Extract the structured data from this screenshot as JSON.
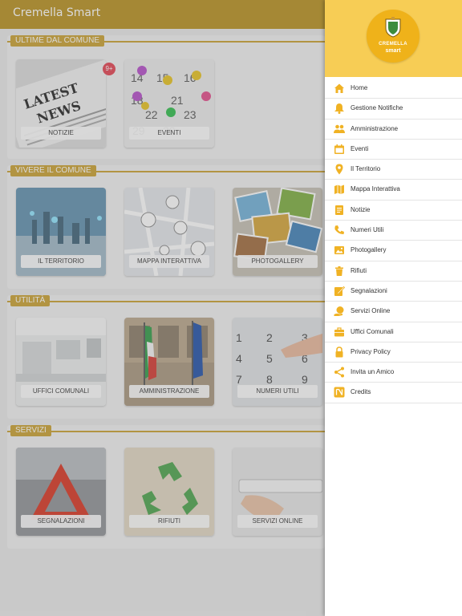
{
  "appbar": {
    "title": "Cremella Smart"
  },
  "sections": [
    {
      "header": "ULTIME DAL COMUNE",
      "tiles": [
        {
          "label": "NOTIZIE",
          "badge": "9+",
          "image": "newspaper-image"
        },
        {
          "label": "EVENTI",
          "image": "calendar-pins-image"
        }
      ]
    },
    {
      "header": "VIVERE IL COMUNE",
      "tiles": [
        {
          "label": "IL TERRITORIO",
          "image": "city-network-image"
        },
        {
          "label": "MAPPA INTERATTIVA",
          "image": "map-pins-image"
        },
        {
          "label": "PHOTOGALLERY",
          "image": "photo-stack-image"
        }
      ]
    },
    {
      "header": "UTILITÀ",
      "tiles": [
        {
          "label": "UFFICI COMUNALI",
          "image": "office-desk-image"
        },
        {
          "label": "AMMINISTRAZIONE",
          "image": "flags-building-image"
        },
        {
          "label": "NUMERI UTILI",
          "image": "keypad-image"
        }
      ]
    },
    {
      "header": "SERVIZI",
      "tiles": [
        {
          "label": "SEGNALAZIONI",
          "image": "warning-triangle-image"
        },
        {
          "label": "RIFIUTI",
          "image": "recycle-image"
        },
        {
          "label": "SERVIZI ONLINE",
          "image": "browser-url-image"
        }
      ]
    }
  ],
  "drawer": {
    "logo": {
      "line1": "CREMELLA",
      "line2": "smart"
    },
    "items": [
      {
        "label": "Home",
        "icon": "home-icon"
      },
      {
        "label": "Gestione Notifiche",
        "icon": "bell-icon"
      },
      {
        "label": "Amministrazione",
        "icon": "people-icon"
      },
      {
        "label": "Eventi",
        "icon": "calendar-icon"
      },
      {
        "label": "Il Territorio",
        "icon": "location-pin-icon"
      },
      {
        "label": "Mappa Interattiva",
        "icon": "map-icon"
      },
      {
        "label": "Notizie",
        "icon": "document-icon"
      },
      {
        "label": "Numeri Utili",
        "icon": "phone-icon"
      },
      {
        "label": "Photogallery",
        "icon": "photo-icon"
      },
      {
        "label": "Rifiuti",
        "icon": "trash-icon"
      },
      {
        "label": "Segnalazioni",
        "icon": "report-icon"
      },
      {
        "label": "Servizi Online",
        "icon": "globe-hand-icon"
      },
      {
        "label": "Uffici Comunali",
        "icon": "briefcase-icon"
      },
      {
        "label": "Privacy Policy",
        "icon": "lock-icon"
      },
      {
        "label": "Invita un Amico",
        "icon": "share-icon"
      },
      {
        "label": "Credits",
        "icon": "credits-icon"
      }
    ]
  },
  "colors": {
    "appbar": "#b88f1c",
    "accent": "#caa02e",
    "drawer_head": "#f7cd55",
    "icon": "#f0b224",
    "badge": "#e34050"
  }
}
